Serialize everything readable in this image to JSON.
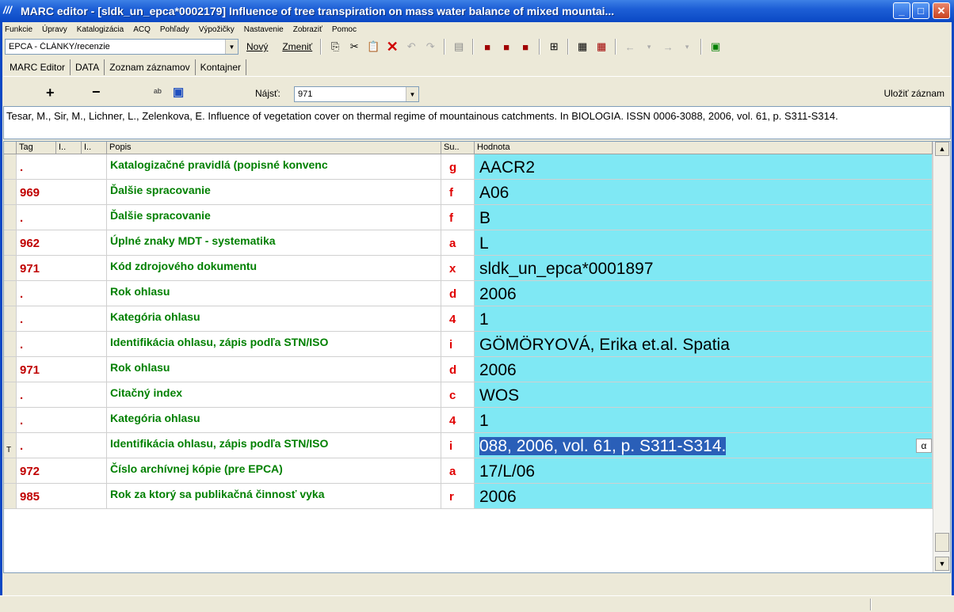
{
  "window": {
    "title": "MARC editor - [sldk_un_epca*0002179] Influence of tree transpiration on mass water balance of mixed mountai...",
    "app_icon_text": "///"
  },
  "menu": [
    "Funkcie",
    "Úpravy",
    "Katalogizácia",
    "ACQ",
    "Pohľady",
    "Výpožičky",
    "Nastavenie",
    "Zobraziť",
    "Pomoc"
  ],
  "toolbar": {
    "combo_value": "EPCA - ČLÁNKY/recenzie",
    "new_label": "Nový",
    "change_label": "Zmeniť"
  },
  "tabs": [
    "MARC Editor",
    "DATA",
    "Zoznam záznamov",
    "Kontajner"
  ],
  "editor": {
    "plus": "+",
    "minus": "−",
    "find_label": "Nájsť:",
    "find_value": "971",
    "save_record": "Uložiť záznam"
  },
  "citation": "Tesar, M., Sir, M., Lichner, L., Zelenkova, E. Influence of vegetation cover on thermal regime of mountainous catchments. In BIOLOGIA. ISSN 0006-3088, 2006, vol. 61, p. S311-S314.",
  "grid": {
    "headers": {
      "tag": "Tag",
      "i1": "I..",
      "i2": "I..",
      "popis": "Popis",
      "sub": "Su..",
      "hodnota": "Hodnota"
    },
    "rows": [
      {
        "ind": "",
        "tag": ".",
        "popis": "Katalogizačné pravidlá (popisné konvenc",
        "sub": "g",
        "value": "AACR2"
      },
      {
        "ind": "",
        "tag": "969",
        "popis": "Ďalšie spracovanie",
        "sub": "f",
        "value": "A06"
      },
      {
        "ind": "",
        "tag": ".",
        "popis": "Ďalšie spracovanie",
        "sub": "f",
        "value": "B"
      },
      {
        "ind": "",
        "tag": "962",
        "popis": "Úplné znaky MDT - systematika",
        "sub": "a",
        "value": "L"
      },
      {
        "ind": "",
        "tag": "971",
        "popis": "Kód zdrojového dokumentu",
        "sub": "x",
        "value": "sldk_un_epca*0001897"
      },
      {
        "ind": "",
        "tag": ".",
        "popis": "Rok ohlasu",
        "sub": "d",
        "value": "2006"
      },
      {
        "ind": "",
        "tag": ".",
        "popis": "Kategória ohlasu",
        "sub": "4",
        "value": "1"
      },
      {
        "ind": "",
        "tag": ".",
        "popis": "Identifikácia ohlasu, zápis podľa STN/ISO",
        "sub": "i",
        "value": "GÖMÖRYOVÁ, Erika et.al. Spatia"
      },
      {
        "ind": "",
        "tag": "971",
        "popis": "Rok ohlasu",
        "sub": "d",
        "value": "2006"
      },
      {
        "ind": "",
        "tag": ".",
        "popis": "Citačný index",
        "sub": "c",
        "value": "WOS"
      },
      {
        "ind": "",
        "tag": ".",
        "popis": "Kategória ohlasu",
        "sub": "4",
        "value": "1"
      },
      {
        "ind": "T",
        "tag": ".",
        "popis": "Identifikácia ohlasu, zápis podľa STN/ISO",
        "sub": "i",
        "value": "088, 2006, vol. 61, p. S311-S314.",
        "selected": true,
        "alpha": "α"
      },
      {
        "ind": "",
        "tag": "972",
        "popis": "Číslo archívnej kópie (pre EPCA)",
        "sub": "a",
        "value": "17/L/06"
      },
      {
        "ind": "",
        "tag": "985",
        "popis": "Rok za ktorý sa publikačná činnosť vyka",
        "sub": "r",
        "value": "2006"
      }
    ]
  }
}
